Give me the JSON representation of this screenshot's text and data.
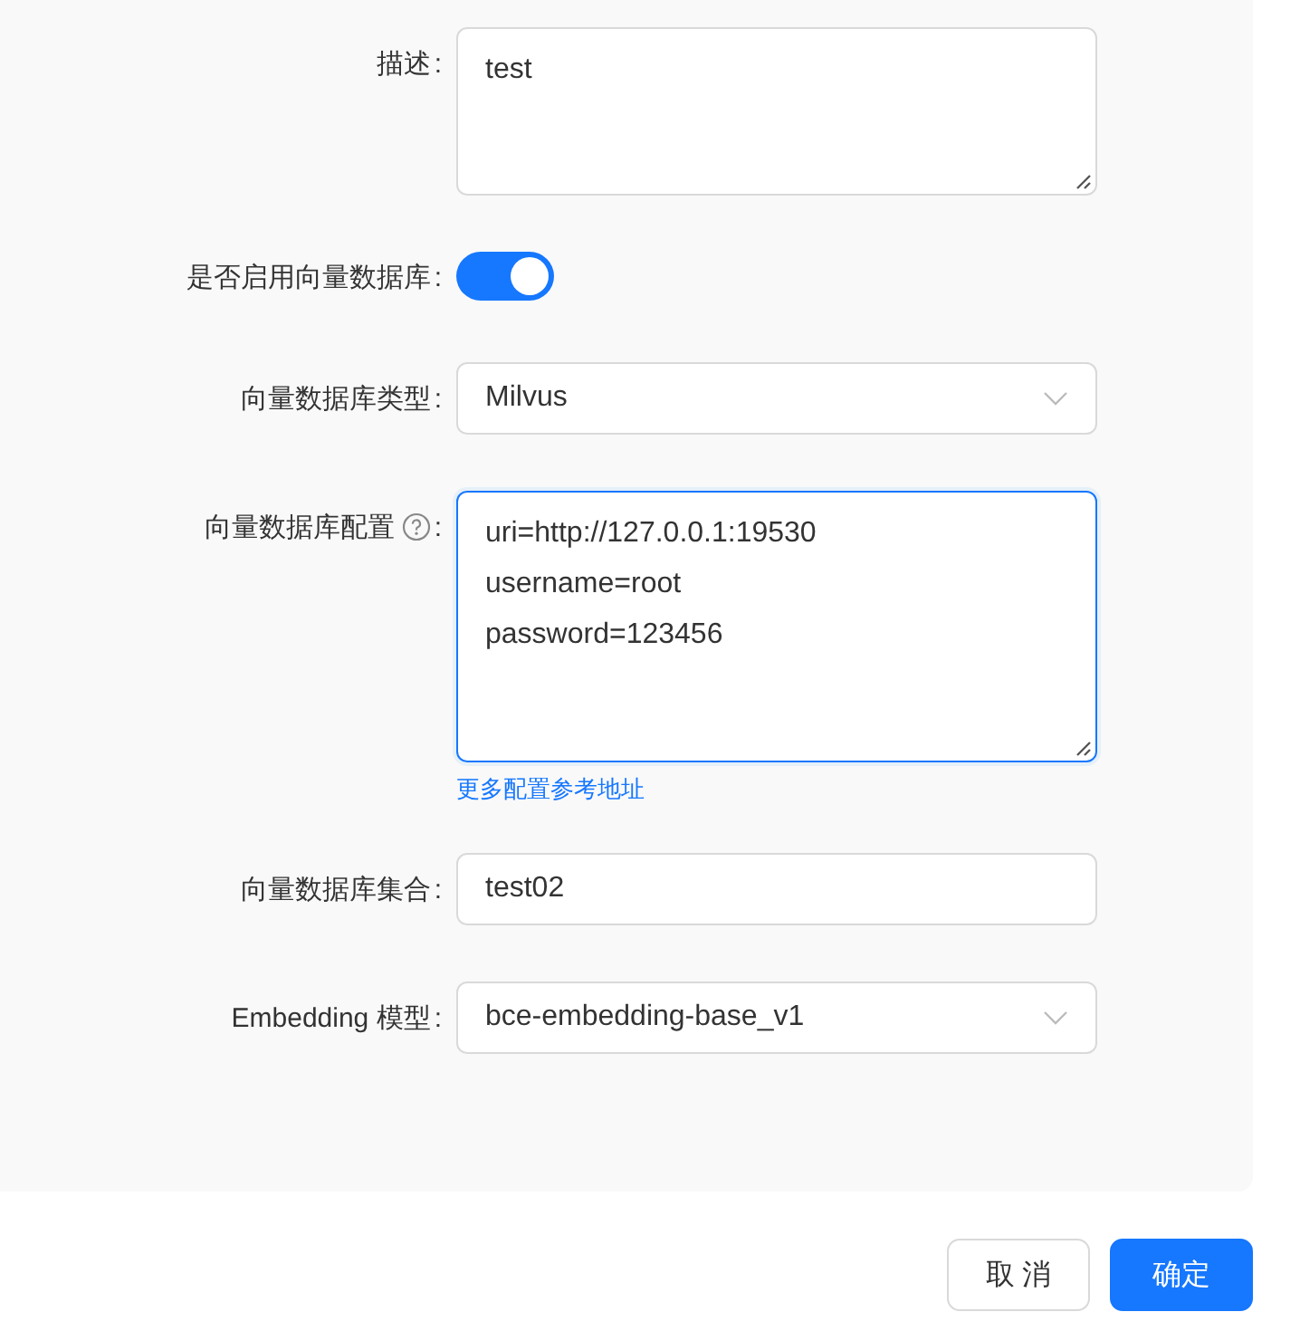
{
  "form": {
    "fields": [
      {
        "kind": "textarea",
        "label": "描述",
        "colon": ":",
        "value": "test",
        "focused": false
      },
      {
        "kind": "switch",
        "label": "是否启用向量数据库",
        "colon": ":",
        "on": true
      },
      {
        "kind": "select",
        "label": "向量数据库类型",
        "colon": ":",
        "value": "Milvus"
      },
      {
        "kind": "textarea",
        "label": "向量数据库配置",
        "colon": ":",
        "help": true,
        "value": "uri=http://127.0.0.1:19530\nusername=root\npassword=123456",
        "focused": true,
        "link": "更多配置参考地址"
      },
      {
        "kind": "input",
        "label": "向量数据库集合",
        "colon": ":",
        "value": "test02"
      },
      {
        "kind": "select",
        "label": "Embedding 模型",
        "colon": ":",
        "value": "bce-embedding-base_v1"
      }
    ]
  },
  "buttons": [
    {
      "label": "取 消",
      "kind": "default"
    },
    {
      "label": "确定",
      "kind": "primary"
    }
  ]
}
